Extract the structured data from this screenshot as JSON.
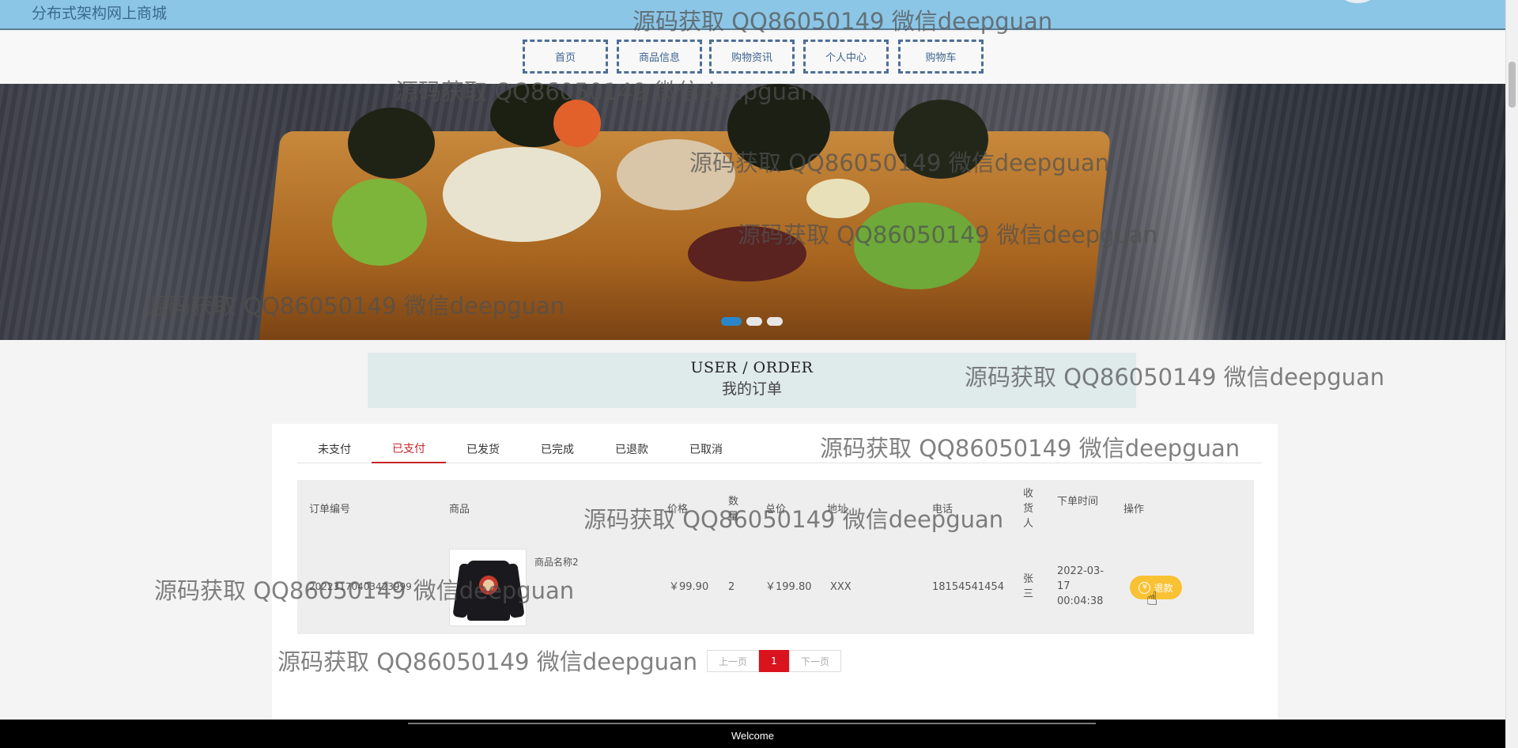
{
  "header": {
    "site_title": "分布式架构网上商城"
  },
  "nav": {
    "items": [
      "首页",
      "商品信息",
      "购物资讯",
      "个人中心",
      "购物车"
    ]
  },
  "order_section": {
    "title_en": "USER / ORDER",
    "title_cn": "我的订单"
  },
  "tabs": [
    "未支付",
    "已支付",
    "已发货",
    "已完成",
    "已退款",
    "已取消"
  ],
  "active_tab": "已支付",
  "table": {
    "headers": {
      "order_no": "订单编号",
      "product": "商品",
      "price": "价格",
      "quantity": "数量",
      "total": "总价",
      "address": "地址",
      "phone": "电话",
      "receiver": "收货人",
      "order_time": "下单时间",
      "action": "操作"
    },
    "rows": [
      {
        "order_no": "20223170403423999",
        "product_name": "商品名称2",
        "price": "￥99.90",
        "quantity": "2",
        "total": "￥199.80",
        "address": "XXX",
        "phone": "18154541454",
        "receiver": "张三",
        "order_time": "2022-03-17 00:04:38",
        "action_label": "退款"
      }
    ]
  },
  "pagination": {
    "prev": "上一页",
    "current": "1",
    "next": "下一页"
  },
  "footer": {
    "text": "Welcome"
  },
  "banner": {
    "slides": 3,
    "active_slide": 1
  },
  "watermark": "源码获取 QQ86050149 微信deepguan",
  "colors": {
    "topbar": "#8cc6e6",
    "nav_border": "#4d6f97",
    "active_tab": "#c8252a",
    "refund_button": "#f8c234",
    "page_active": "#d9141e"
  }
}
